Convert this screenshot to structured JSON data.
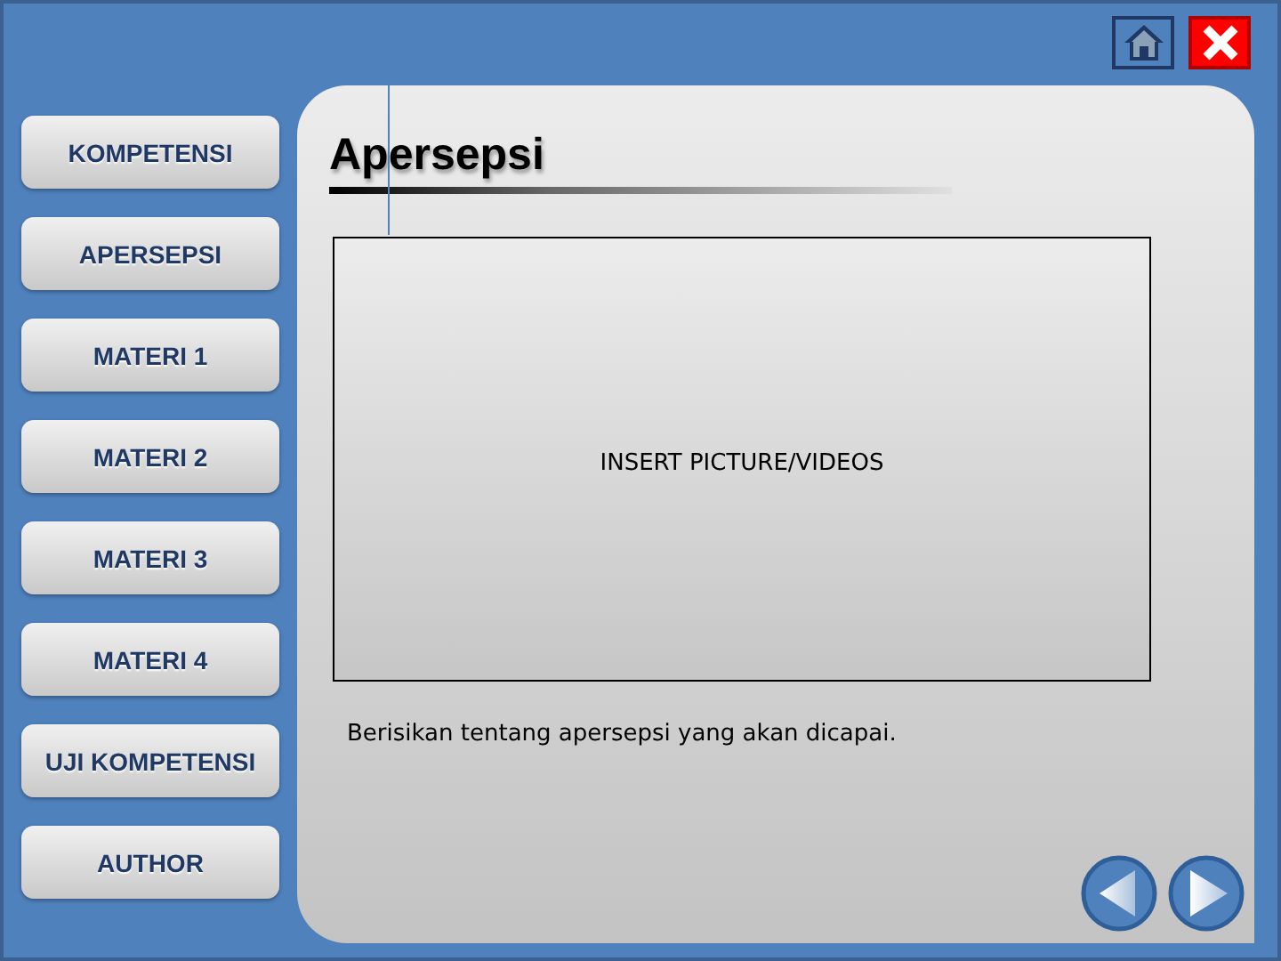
{
  "menu": [
    {
      "label": "KOMPETENSI"
    },
    {
      "label": "APERSEPSI"
    },
    {
      "label": "MATERI 1"
    },
    {
      "label": "MATERI 2"
    },
    {
      "label": "MATERI 3"
    },
    {
      "label": "MATERI 4"
    },
    {
      "label": "UJI KOMPETENSI"
    },
    {
      "label": "AUTHOR"
    }
  ],
  "title": "Apersepsi",
  "media_placeholder": "INSERT PICTURE/VIDEOS",
  "description": "Berisikan tentang apersepsi yang akan dicapai."
}
